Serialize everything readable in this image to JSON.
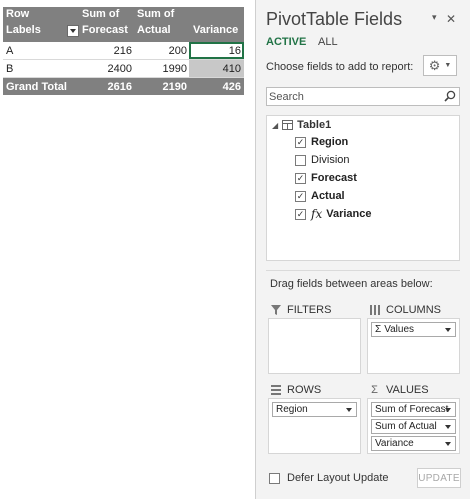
{
  "pivot": {
    "header": {
      "row_labels": "Row Labels",
      "sum_forecast_l1": "Sum of",
      "sum_forecast_l2": "Forecast",
      "sum_actual_l1": "Sum of",
      "sum_actual_l2": "Actual",
      "variance": "Variance"
    },
    "rows": [
      {
        "label": "A",
        "forecast": "216",
        "actual": "200",
        "variance": "16"
      },
      {
        "label": "B",
        "forecast": "2400",
        "actual": "1990",
        "variance": "410"
      }
    ],
    "total": {
      "label": "Grand Total",
      "forecast": "2616",
      "actual": "2190",
      "variance": "426"
    }
  },
  "pane": {
    "title": "PivotTable Fields",
    "close_glyph": "✕",
    "dropdown_glyph": "▾",
    "tabs": {
      "active": "ACTIVE",
      "all": "ALL"
    },
    "choose_label": "Choose fields to add to report:",
    "search_placeholder": "Search",
    "table_name": "Table1",
    "fields": [
      {
        "name": "Region",
        "checked": true,
        "mark": "✓"
      },
      {
        "name": "Division",
        "checked": false,
        "mark": ""
      },
      {
        "name": "Forecast",
        "checked": true,
        "mark": "✓"
      },
      {
        "name": "Actual",
        "checked": true,
        "mark": "✓"
      },
      {
        "name": "Variance",
        "checked": true,
        "mark": "✓",
        "fx": "fx"
      }
    ],
    "drag_label": "Drag fields between areas below:",
    "areas": {
      "filters": {
        "title": "FILTERS",
        "items": []
      },
      "columns": {
        "title": "COLUMNS",
        "items": [
          "Values"
        ]
      },
      "rows": {
        "title": "ROWS",
        "items": [
          "Region"
        ]
      },
      "values": {
        "title": "VALUES",
        "items": [
          "Sum of Forecast",
          "Sum of Actual",
          "Variance"
        ]
      }
    },
    "sigma_glyph": "Σ",
    "defer_label": "Defer Layout Update",
    "update_label": "UPDATE"
  },
  "colors": {
    "accent_green": "#217346",
    "header_gray": "#808080",
    "pane_bg": "#f3f3f3"
  }
}
